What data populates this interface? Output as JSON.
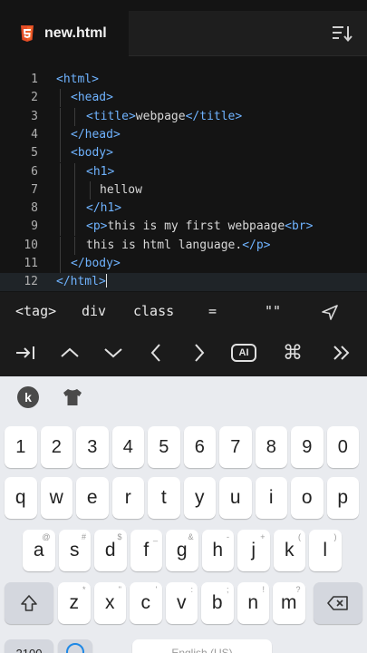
{
  "tab": {
    "filename": "new.html"
  },
  "editor": {
    "lines": [
      {
        "num": "1",
        "html": "<span class='tg'>&lt;html&gt;</span>"
      },
      {
        "num": "2",
        "html": "<span class='tg'>&lt;head&gt;</span>"
      },
      {
        "num": "3",
        "html": "<span class='tg'>&lt;title&gt;</span>webpage<span class='tg'>&lt;/title&gt;</span>"
      },
      {
        "num": "4",
        "html": "<span class='tg'>&lt;/head&gt;</span>"
      },
      {
        "num": "5",
        "html": "<span class='tg'>&lt;body&gt;</span>"
      },
      {
        "num": "6",
        "html": "<span class='tg'>&lt;h1&gt;</span>"
      },
      {
        "num": "7",
        "html": "hellow"
      },
      {
        "num": "8",
        "html": "<span class='tg'>&lt;/h1&gt;</span>"
      },
      {
        "num": "9",
        "html": "<span class='tg'>&lt;p&gt;</span>this is my first webpaage<span class='tg'>&lt;br&gt;</span>"
      },
      {
        "num": "10",
        "html": "this is html language.<span class='tg'>&lt;/p&gt;</span>"
      },
      {
        "num": "11",
        "html": "<span class='tg'>&lt;/body&gt;</span>"
      },
      {
        "num": "12",
        "html": "<span class='tg'>&lt;/html&gt;</span><span class='cursor'></span>"
      }
    ]
  },
  "accessory": {
    "row1": [
      "<tag>",
      "div",
      "class",
      "=",
      "\"\""
    ],
    "row2_icons": [
      "tab-icon",
      "caret-up-icon",
      "caret-down-icon",
      "chevron-left-icon",
      "chevron-right-icon",
      "ai-icon",
      "command-icon",
      "double-chevron-right-icon"
    ],
    "ai_label": "AI"
  },
  "keyboard": {
    "numbers": [
      "1",
      "2",
      "3",
      "4",
      "5",
      "6",
      "7",
      "8",
      "9",
      "0"
    ],
    "row1": [
      "q",
      "w",
      "e",
      "r",
      "t",
      "y",
      "u",
      "i",
      "o",
      "p"
    ],
    "row2": [
      "a",
      "s",
      "d",
      "f",
      "g",
      "h",
      "j",
      "k",
      "l"
    ],
    "row2_hints": [
      "@",
      "#",
      "$",
      "_",
      "&",
      "-",
      "+",
      "(",
      ")"
    ],
    "row3": [
      "z",
      "x",
      "c",
      "v",
      "b",
      "n",
      "m"
    ],
    "row3_hints": [
      "*",
      "\"",
      "'",
      ":",
      ";",
      "!",
      "?"
    ],
    "bottom_partial": [
      "2100",
      "English (US)"
    ],
    "colors": {
      "bg": "#e9ebef",
      "key": "#ffffff",
      "special": "#d4d7de"
    }
  },
  "colors": {
    "editor_bg": "#141414",
    "tag": "#6fb3ff",
    "text": "#d8d8d8",
    "linenum": "#b0b0b0"
  }
}
